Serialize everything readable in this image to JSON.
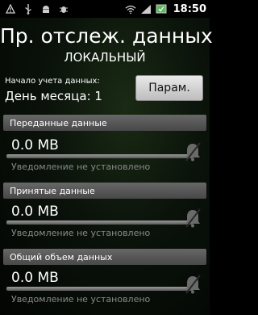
{
  "statusbar": {
    "time": "18:50",
    "icons_left": [
      "alert-icon",
      "usb-icon",
      "android-icon",
      "bug-icon"
    ],
    "icons_right": [
      "wifi-icon",
      "signal-icon",
      "battery-icon"
    ]
  },
  "header": {
    "title": "Пр. отслеж. данных",
    "subtitle": "ЛОКАЛЬНЫЙ"
  },
  "settings": {
    "start_label": "Начало учета данных:",
    "start_value": "День месяца: 1",
    "params_button": "Парам."
  },
  "sections": [
    {
      "header": "Переданные данные",
      "value": "0.0 MB",
      "note": "Уведомление не установлено",
      "icon": "bell-off-icon"
    },
    {
      "header": "Принятые данные",
      "value": "0.0 MB",
      "note": "Уведомление не установлено",
      "icon": "bell-off-icon"
    },
    {
      "header": "Общий объем данных",
      "value": "0.0 MB",
      "note": "Уведомление не установлено",
      "icon": "bell-off-icon"
    }
  ]
}
